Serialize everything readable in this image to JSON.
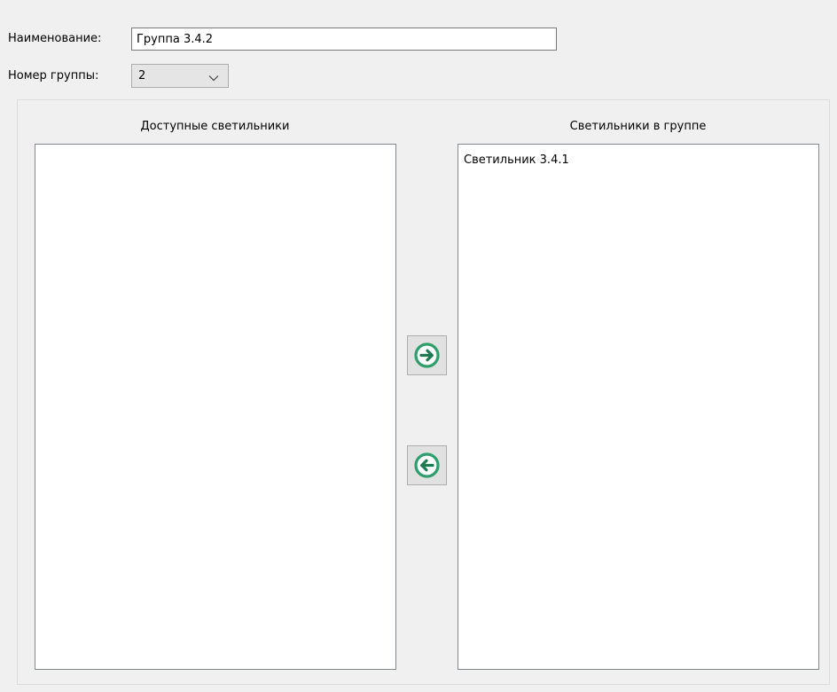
{
  "form": {
    "name_label": "Наименование:",
    "name_value": "Группа 3.4.2",
    "group_number_label": "Номер группы:",
    "group_number_value": "2"
  },
  "available": {
    "header": "Доступные светильники",
    "items": []
  },
  "in_group": {
    "header": "Светильники в группе",
    "items": [
      "Светильник 3.4.1"
    ]
  },
  "icons": {
    "move_right": "arrow-right-circle-icon",
    "move_left": "arrow-left-circle-icon",
    "dropdown": "chevron-down-icon"
  },
  "colors": {
    "accent_green": "#2e9e6b",
    "accent_green_dark": "#1f7a50"
  }
}
